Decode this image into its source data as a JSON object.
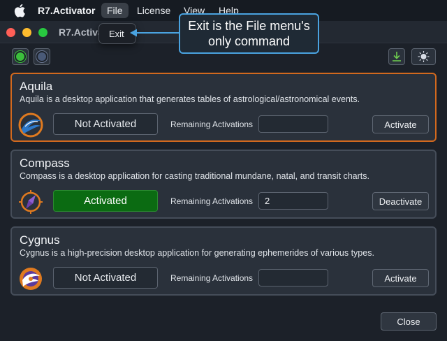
{
  "menubar": {
    "app_name": "R7.Activator",
    "items": [
      "File",
      "License",
      "View",
      "Help"
    ]
  },
  "window": {
    "title": "R7.Activator"
  },
  "file_menu": {
    "items": [
      "Exit"
    ]
  },
  "annotation": {
    "text": "Exit is the File menu's only command"
  },
  "toolbar": {
    "icons": [
      "green-circle-icon",
      "blue-circle-icon",
      "download-icon",
      "sun-icon"
    ]
  },
  "products": [
    {
      "name": "Aquila",
      "description": "Aquila is a desktop application that generates tables of astrological/astronomical events.",
      "status": "Not Activated",
      "remaining_label": "Remaining Activations",
      "remaining_value": "",
      "action": "Activate",
      "icon": "aquila-logo-icon"
    },
    {
      "name": "Compass",
      "description": "Compass is a desktop application for casting traditional mundane, natal, and transit charts.",
      "status": "Activated",
      "remaining_label": "Remaining Activations",
      "remaining_value": "2",
      "action": "Deactivate",
      "icon": "compass-logo-icon"
    },
    {
      "name": "Cygnus",
      "description": "Cygnus is a high-precision desktop application for generating ephemerides of various types.",
      "status": "Not Activated",
      "remaining_label": "Remaining Activations",
      "remaining_value": "",
      "action": "Activate",
      "icon": "cygnus-logo-icon"
    }
  ],
  "footer": {
    "close_label": "Close"
  },
  "colors": {
    "selected_border": "#d2691e",
    "activated_bg": "#0b6b12",
    "callout_border": "#4aa3e0"
  }
}
